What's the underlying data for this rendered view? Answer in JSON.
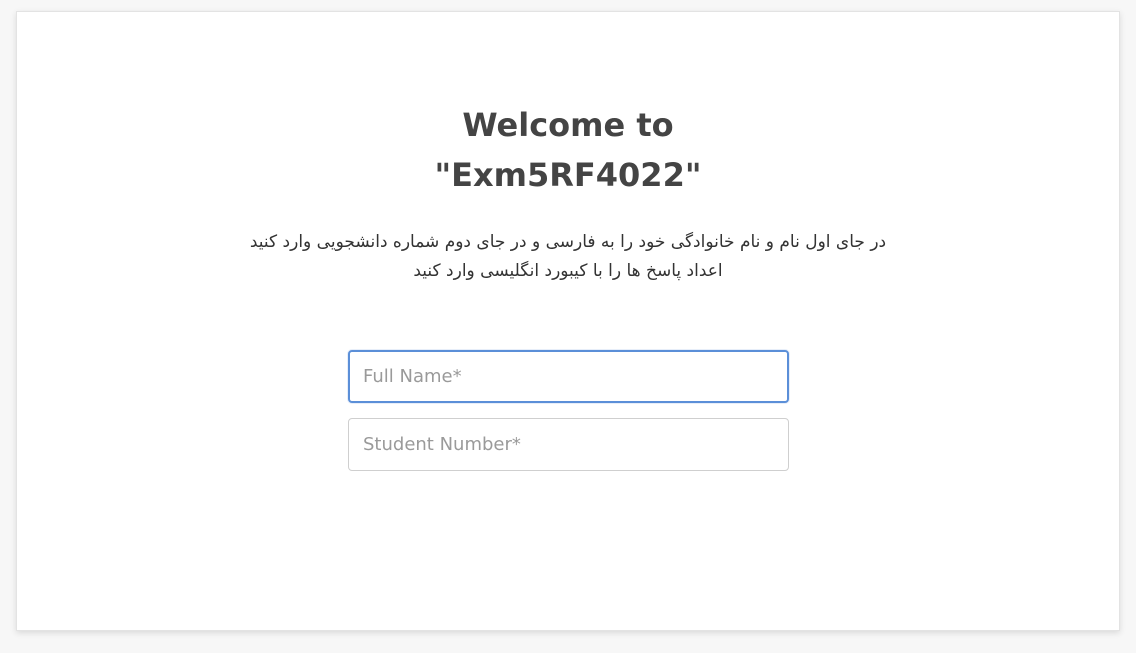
{
  "header": {
    "welcome_line": "Welcome to",
    "exam_name": "\"Exm5RF4022\""
  },
  "instructions": {
    "line1": "در جای اول نام و نام خانوادگی خود را به فارسی و در جای دوم شماره دانشجویی وارد کنید",
    "line2": "اعداد پاسخ ها را با کیبورد انگلیسی وارد کنید"
  },
  "form": {
    "full_name": {
      "value": "",
      "placeholder": "Full Name*"
    },
    "student_number": {
      "value": "",
      "placeholder": "Student Number*"
    }
  },
  "colors": {
    "focus_border": "#5b8fd8",
    "title_text": "#444444"
  }
}
